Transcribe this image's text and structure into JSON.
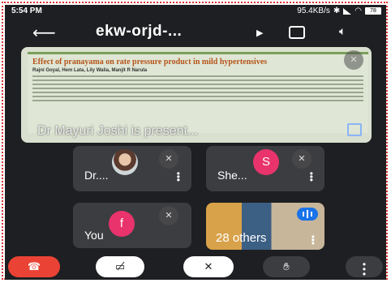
{
  "status_bar": {
    "time": "5:54 PM",
    "net_speed": "95.4KB/s",
    "battery": "78"
  },
  "header": {
    "back_icon": "arrow-left-icon",
    "meeting_code": "ekw-orjd-...",
    "cast_icon": "cast-icon",
    "switch_camera_icon": "switch-camera-icon",
    "volume_icon": "volume-icon"
  },
  "presentation": {
    "slide_title": "Effect of pranayama on rate pressure product in mild hypertensives",
    "slide_authors": "Rajni Goyal, Hem Lata, Lily Walia, Manjit R Narula",
    "presenter_label": "Dr Mayuri Joshi is present..."
  },
  "participants": [
    {
      "name": "Dr....",
      "avatar_type": "photo",
      "muted": true
    },
    {
      "name": "She...",
      "initial": "S",
      "avatar_color": "#e8336d",
      "muted": true
    },
    {
      "name": "You",
      "initial": "f",
      "avatar_color": "#e8336d",
      "muted": true
    },
    {
      "name": "28 others",
      "avatar_type": "photo",
      "speaking": true
    }
  ],
  "controls": {
    "end_call_icon": "end-call-icon",
    "camera_off_icon": "camera-off-icon",
    "mic_off_icon": "mic-off-icon",
    "raise_hand_icon": "raise-hand-icon",
    "more_icon": "more-vertical-icon"
  },
  "colors": {
    "background": "#1e1f22",
    "tile": "#3c3d40",
    "end_call": "#ea4335",
    "accent": "#1a73e8",
    "avatar_pink": "#e8336d"
  }
}
